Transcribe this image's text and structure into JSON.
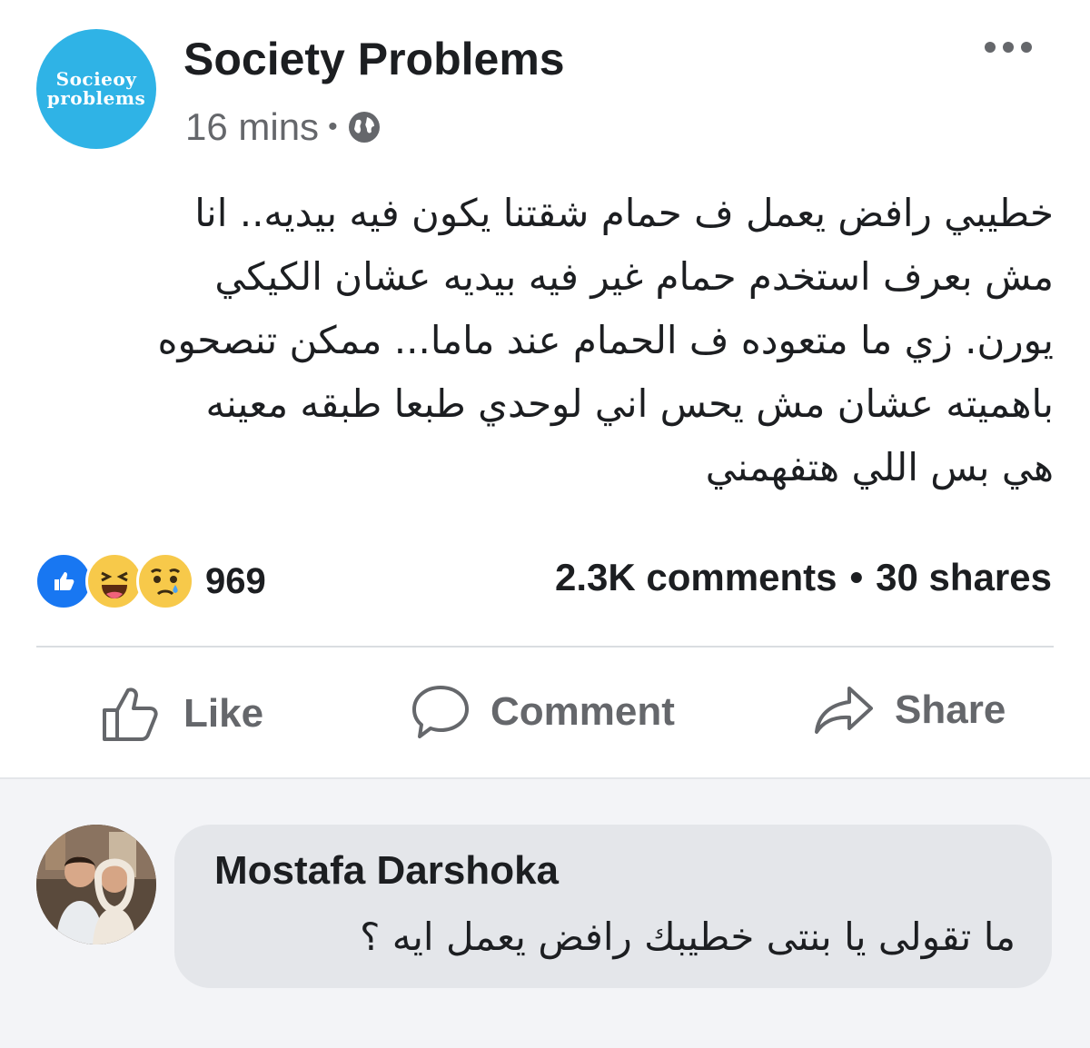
{
  "post": {
    "page_name": "Society Problems",
    "avatar_text_line1": "Socieoy",
    "avatar_text_line2": "problems",
    "time": "16 mins",
    "separator": "•",
    "privacy_icon": "globe-icon",
    "more_icon": "more-options-icon",
    "text_lines": [
      "خطيبي رافض يعمل ف حمام شقتنا يكون فيه بيديه.. انا",
      "مش بعرف استخدم حمام غير فيه بيديه عشان الكيكي",
      "يورن. زي ما متعوده ف الحمام عند ماما... ممكن تنصحوه",
      "باهميته عشان مش يحس اني لوحدي طبعا طبقه معينه",
      "هي بس اللي هتفهمني"
    ],
    "reactions": {
      "icons": [
        "like-reaction-icon",
        "haha-reaction-icon",
        "sad-reaction-icon"
      ],
      "count": "969"
    },
    "comments_count": "2.3K comments",
    "stats_separator": "•",
    "shares_count": "30 shares"
  },
  "actions": {
    "like_label": "Like",
    "comment_label": "Comment",
    "share_label": "Share"
  },
  "comment": {
    "author": "Mostafa Darshoka",
    "text": "ما تقولى يا بنتى خطيبك رافض يعمل ايه ؟"
  },
  "colors": {
    "page_avatar": "#2fb3e6",
    "like_blue": "#1877f2",
    "reaction_yellow": "#f7c94a",
    "secondary_text": "#65676b",
    "comment_bubble": "#e4e6ea"
  }
}
